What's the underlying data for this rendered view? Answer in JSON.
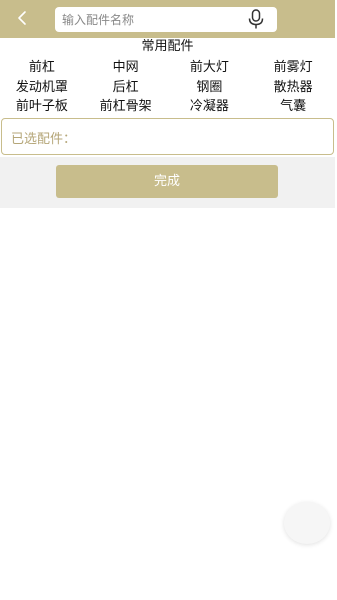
{
  "header": {
    "bg_color": "#c8bd8c",
    "back_icon": "chevron-left-icon",
    "search": {
      "placeholder": "输入配件名称",
      "value": "",
      "voice_icon": "microphone-icon"
    }
  },
  "parts": {
    "title": "常用配件",
    "items": [
      {
        "label": "前杠"
      },
      {
        "label": "中网"
      },
      {
        "label": "前大灯"
      },
      {
        "label": "前雾灯"
      },
      {
        "label": "发动机罩"
      },
      {
        "label": "后杠"
      },
      {
        "label": "钢圈"
      },
      {
        "label": "散热器"
      },
      {
        "label": "前叶子板"
      },
      {
        "label": "前杠骨架"
      },
      {
        "label": "冷凝器"
      },
      {
        "label": "气囊"
      }
    ]
  },
  "selected": {
    "label": "已选配件："
  },
  "done_button": {
    "label": "完成"
  },
  "colors": {
    "accent": "#c8bd8c",
    "action_bg": "#f1f1f1"
  }
}
